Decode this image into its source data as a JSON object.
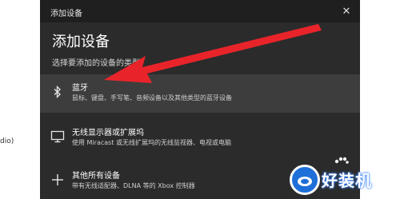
{
  "background": {
    "side_text": "dio)"
  },
  "dialog": {
    "window_title": "添加设备",
    "close_glyph": "✕",
    "heading": "添加设备",
    "subtitle": "选择要添加的设备的类型。",
    "options": [
      {
        "icon": "bluetooth-icon",
        "label": "蓝牙",
        "description": "鼠标、键盘、手写笔、音频设备以及其他类型的蓝牙设备",
        "selected": true
      },
      {
        "icon": "monitor-icon",
        "label": "无线显示器或扩展坞",
        "description": "使用 Miracast 或无线扩展坞的无线监视器、电视或电脑",
        "selected": false
      },
      {
        "icon": "plus-icon",
        "label": "其他所有设备",
        "description": "带有无线适配器、DLNA 等的 Xbox 控制器",
        "selected": false
      }
    ]
  },
  "watermark": {
    "text": "好装机"
  },
  "colors": {
    "dialog_bg": "#2b2b2b",
    "titlebar_bg": "#1f1f1f",
    "selected_row_bg": "#3d3d3d",
    "arrow": "#e8242a",
    "watermark_blue": "#1e6fd8"
  }
}
